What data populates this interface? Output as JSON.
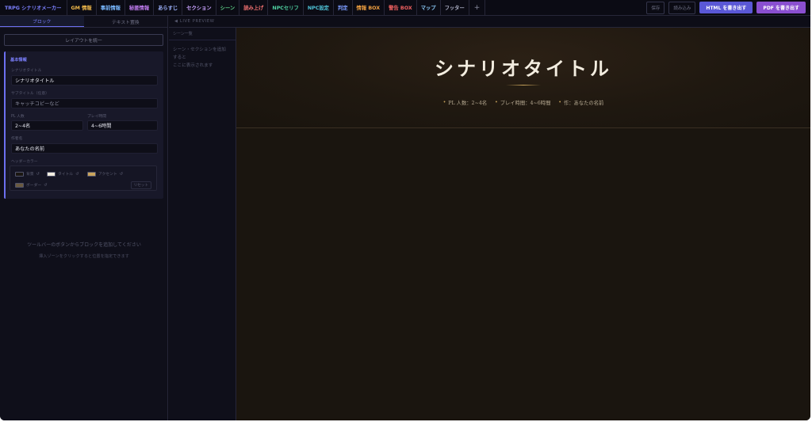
{
  "toolbar": {
    "brand": "TRPG シナリオメーカー",
    "brand_color": "#7c80ff",
    "items": [
      {
        "label": "GM 情報",
        "color": "#f0b84a"
      },
      {
        "label": "事前情報",
        "color": "#79b8ff"
      },
      {
        "label": "秘匿情報",
        "color": "#c07cf0"
      },
      {
        "label": "あらすじ",
        "color": "#9fb4ff"
      },
      {
        "label": "セクション",
        "color": "#c9a3ff"
      },
      {
        "label": "シーン",
        "color": "#5fd38a"
      },
      {
        "label": "読み上げ",
        "color": "#f07070"
      },
      {
        "label": "NPCセリフ",
        "color": "#4fd0a0"
      },
      {
        "label": "NPC設定",
        "color": "#4fc4d8"
      },
      {
        "label": "判定",
        "color": "#7c9cff"
      },
      {
        "label": "情報 BOX",
        "color": "#f0a040"
      },
      {
        "label": "警告 BOX",
        "color": "#f06060"
      },
      {
        "label": "マップ",
        "color": "#8fd0ff"
      },
      {
        "label": "フッター",
        "color": "#b0b3c8"
      }
    ],
    "plus": "+",
    "save": "保存",
    "load": "読み込み",
    "export_html": "HTML を書き出す",
    "export_pdf": "PDF を書き出す"
  },
  "left_panel": {
    "tabs": [
      "ブロック",
      "テキスト置換"
    ],
    "unify_button": "レイアウトを統一",
    "basic_card": {
      "title": "基本情報",
      "scenario_title_label": "シナリオタイトル",
      "scenario_title_value": "シナリオタイトル",
      "subtitle_label": "サブタイトル（任意）",
      "subtitle_placeholder": "キャッチコピーなど",
      "pl_label": "PL 人数",
      "pl_value": "2~4名",
      "play_time_label": "プレイ時間",
      "play_time_value": "4~6時間",
      "author_label": "作者名",
      "author_value": "あなたの名前",
      "header_color_label": "ヘッダーカラー",
      "swatches": [
        {
          "label": "背景",
          "color": "#1b1712"
        },
        {
          "label": "タイトル",
          "color": "#f3ede0"
        },
        {
          "label": "アクセント",
          "color": "#c9a45c"
        },
        {
          "label": "ボーダー",
          "color": "#6a5a40"
        }
      ],
      "reset_glyph": "↺",
      "reset_button": "リセット"
    },
    "empty_message": "ツールバーのボタンからブロックを追加してください",
    "empty_hint": "挿入ゾーンをクリックすると位置を指定できます"
  },
  "preview": {
    "header": "◀ LIVE PREVIEW",
    "scene_list_title": "シーン一覧",
    "scene_list_hint": "シーン・セクションを追加\nすると\nここに表示されます",
    "hero_title": "シナリオタイトル",
    "meta": [
      "PL 人数：2~4名",
      "プレイ時間：4~6時間",
      "作：あなたの名前"
    ],
    "meta_bullet": "•"
  }
}
